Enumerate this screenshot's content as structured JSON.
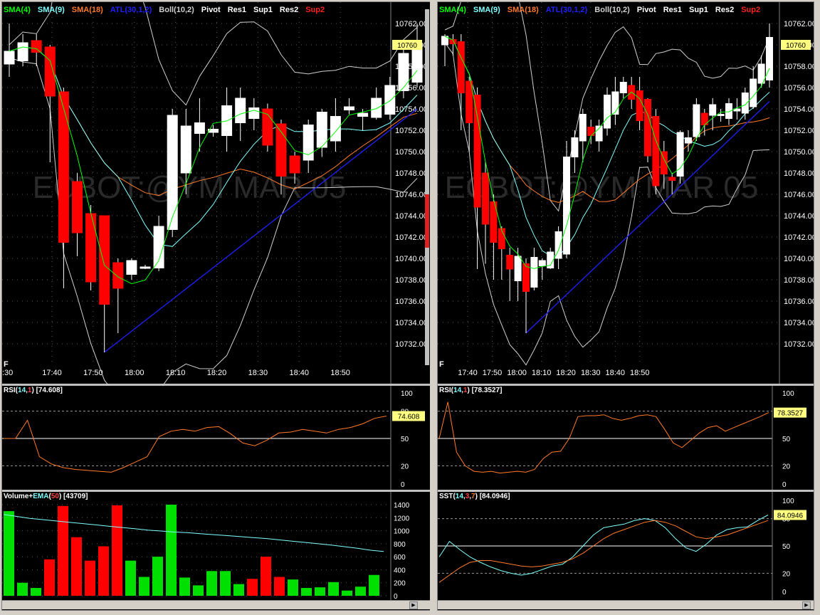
{
  "colors": {
    "up": "#ffffff",
    "down": "#ff0000",
    "sma4": "#00ff00",
    "sma9": "#7fffff",
    "sma18": "#ff7a2a",
    "atl": "#2020ff",
    "boll": "#cfcfcf",
    "pivot": "#ffffff",
    "res1": "#ffffff",
    "sup1": "#ffffff",
    "res2": "#ffffff",
    "sup2": "#ff2020",
    "label_bg": "#ffff80",
    "rsi_line": "#ff7a2a",
    "vol_up": "#00e000",
    "vol_down": "#ff0000",
    "ema": "#7fffff",
    "sst_k": "#7fffff",
    "sst_d": "#ff7a2a"
  },
  "left": {
    "legend": {
      "sma4": "SMA(4)",
      "sma9": "SMA(9)",
      "sma18": "SMA(18)",
      "atl": "ATL(30,1,2)",
      "boll": "Boll(10,2)",
      "pivot": "Pivot",
      "res1": "Res1",
      "sup1": "Sup1",
      "res2": "Res2",
      "sup2": "Sup2"
    },
    "watermark": "ECBOT:@YM  MAR 05",
    "corner_letter": "F",
    "last_price_label": "10760",
    "price_ticks": [
      "10762.00",
      "10760.00",
      "10758.00",
      "10756.00",
      "10754.00",
      "10752.00",
      "10750.00",
      "10748.00",
      "10746.00",
      "10744.00",
      "10742.00",
      "10740.00",
      "10738.00",
      "10736.00",
      "10734.00",
      "10732.00"
    ],
    "time_ticks": [
      "17:40",
      "17:50",
      "18:00",
      "18:10",
      "18:20",
      "18:30",
      "18:40",
      "18:50"
    ],
    "first_time_fragment": ":30",
    "candles": [
      [
        10758.2,
        10759.4,
        10762,
        10757
      ],
      [
        10758.5,
        10760.2,
        10761,
        10758
      ],
      [
        10760.4,
        10759.3,
        10761,
        10758
      ],
      [
        10759.8,
        10755.2,
        10760,
        10749
      ],
      [
        10755.6,
        10741.5,
        10756,
        10737.2
      ],
      [
        10747.2,
        10742.4,
        10748,
        10740.2
      ],
      [
        10744.2,
        10737.8,
        10745,
        10737
      ],
      [
        10744.0,
        10735.7,
        10744,
        10731.2
      ],
      [
        10739.6,
        10737.2,
        10740,
        10733
      ],
      [
        10738.5,
        10739.8,
        10740,
        10738
      ],
      [
        10739.1,
        10739.2,
        10739.4,
        10739
      ],
      [
        10739.1,
        10743.0,
        10744,
        10738.8
      ],
      [
        10742.7,
        10753.4,
        10754,
        10742
      ],
      [
        10748.0,
        10752.4,
        10754,
        10746
      ],
      [
        10751.7,
        10752.7,
        10755,
        10750
      ],
      [
        10751.8,
        10752.1,
        10752.5,
        10751.4
      ],
      [
        10751.5,
        10754.3,
        10756,
        10750
      ],
      [
        10752.7,
        10755.0,
        10756,
        10751
      ],
      [
        10753.1,
        10754.1,
        10755,
        10752
      ],
      [
        10754.0,
        10750.6,
        10754.5,
        10750
      ],
      [
        10752.6,
        10747.7,
        10753,
        10746
      ],
      [
        10749.6,
        10748.0,
        10750,
        10747
      ],
      [
        10749.2,
        10752.5,
        10753,
        10748
      ],
      [
        10750.4,
        10753.7,
        10754,
        10749.5
      ],
      [
        10751.0,
        10753.3,
        10755,
        10750
      ],
      [
        10753.9,
        10754.2,
        10755,
        10753.5
      ],
      [
        10753.3,
        10753.6,
        10754,
        10752
      ],
      [
        10753.2,
        10755.0,
        10756,
        10753
      ],
      [
        10753.5,
        10756.2,
        10757,
        10753
      ],
      [
        10755.7,
        10759.2,
        10760,
        10755
      ],
      [
        10756.5,
        10760.0,
        10762,
        10756
      ]
    ],
    "rsi_header": {
      "name": "RSI",
      "p1": "14",
      "p2": "1",
      "value": "[74.608]"
    },
    "rsi_ticks": [
      "100",
      "80",
      "50",
      "20",
      "0"
    ],
    "rsi_label": "74.608",
    "rsi": [
      50,
      50,
      70,
      30,
      22,
      18,
      16,
      15,
      14,
      13,
      18,
      24,
      30,
      52,
      58,
      60,
      58,
      62,
      63,
      55,
      45,
      42,
      48,
      56,
      57,
      60,
      58,
      56,
      60,
      62,
      66,
      72,
      74.6
    ],
    "volume_header": {
      "name": "Volume",
      "plus": "+",
      "ema": "EMA",
      "p": "50",
      "value": "[43709]"
    },
    "volume_ticks": [
      "1400",
      "1200",
      "1000",
      "800",
      "600",
      "400",
      "200",
      "0"
    ],
    "volume": [
      [
        1300,
        "u"
      ],
      [
        200,
        "u"
      ],
      [
        120,
        "u"
      ],
      [
        560,
        "d"
      ],
      [
        1380,
        "d"
      ],
      [
        900,
        "d"
      ],
      [
        540,
        "d"
      ],
      [
        760,
        "d"
      ],
      [
        1390,
        "d"
      ],
      [
        540,
        "u"
      ],
      [
        290,
        "u"
      ],
      [
        600,
        "u"
      ],
      [
        1400,
        "u"
      ],
      [
        280,
        "u"
      ],
      [
        160,
        "u"
      ],
      [
        380,
        "u"
      ],
      [
        380,
        "u"
      ],
      [
        180,
        "u"
      ],
      [
        260,
        "d"
      ],
      [
        600,
        "d"
      ],
      [
        290,
        "d"
      ],
      [
        250,
        "u"
      ],
      [
        120,
        "u"
      ],
      [
        130,
        "u"
      ],
      [
        210,
        "u"
      ],
      [
        80,
        "u"
      ],
      [
        140,
        "u"
      ],
      [
        320,
        "u"
      ]
    ],
    "ema": [
      1250,
      1220,
      1190,
      1170,
      1150,
      1130,
      1110,
      1090,
      1070,
      1050,
      1030,
      1010,
      995,
      980,
      970,
      955,
      940,
      925,
      910,
      895,
      880,
      860,
      840,
      820,
      800,
      780,
      755,
      730,
      700,
      680
    ]
  },
  "right": {
    "legend": {
      "sma4": "SMA(4)",
      "sma9": "SMA(9)",
      "sma18": "SMA(18)",
      "atl": "ATL(30,1,2)",
      "boll": "Boll(10,2)",
      "pivot": "Pivot",
      "res1": "Res1",
      "sup1": "Sup1",
      "res2": "Res2",
      "sup2": "Sup2"
    },
    "watermark": "ECBOT:@YM  MAR 05",
    "corner_letter": "F",
    "last_price_label": "10760",
    "price_ticks": [
      "10762.00",
      "10760.00",
      "10758.00",
      "10756.00",
      "10754.00",
      "10752.00",
      "10750.00",
      "10748.00",
      "10746.00",
      "10744.00",
      "10742.00",
      "10740.00",
      "10738.00",
      "10736.00",
      "10734.00",
      "10732.00"
    ],
    "time_ticks": [
      "17:40",
      "17:50",
      "18:00",
      "18:10",
      "18:20",
      "18:30",
      "18:40",
      "18:50"
    ],
    "candles": [
      [
        10760.0,
        10760.8,
        10761,
        10758
      ],
      [
        10760.5,
        10760.1,
        10761,
        10759
      ],
      [
        10760.3,
        10755.5,
        10761,
        10752
      ],
      [
        10756.6,
        10752.7,
        10757,
        10750
      ],
      [
        10755.3,
        10744.8,
        10756,
        10739
      ],
      [
        10748.0,
        10743.2,
        10749,
        10739.5
      ],
      [
        10745.3,
        10741.5,
        10746,
        10738
      ],
      [
        10742.8,
        10740.9,
        10743,
        10738
      ],
      [
        10740.3,
        10739.0,
        10741,
        10736
      ],
      [
        10737.9,
        10740.2,
        10741,
        10736
      ],
      [
        10739.5,
        10736.9,
        10740,
        10733
      ],
      [
        10737.3,
        10740.1,
        10741,
        10737
      ],
      [
        10739.3,
        10739.8,
        10740,
        10738
      ],
      [
        10739.1,
        10740.6,
        10741,
        10739
      ],
      [
        10740.0,
        10742.5,
        10743,
        10739
      ],
      [
        10740.4,
        10749.5,
        10751,
        10740
      ],
      [
        10749.5,
        10751.3,
        10752,
        10748
      ],
      [
        10751.0,
        10753.5,
        10754,
        10749
      ],
      [
        10752.3,
        10751.5,
        10753,
        10750.7
      ],
      [
        10751.0,
        10752.4,
        10753,
        10750
      ],
      [
        10752.2,
        10755.3,
        10756,
        10751.5
      ],
      [
        10753.5,
        10755.6,
        10757,
        10752.5
      ],
      [
        10755.5,
        10756.5,
        10757,
        10755
      ],
      [
        10756.2,
        10754.9,
        10757,
        10754
      ],
      [
        10755.7,
        10752.9,
        10757,
        10752
      ],
      [
        10754.9,
        10749.6,
        10755,
        10749
      ],
      [
        10753.3,
        10746.8,
        10754,
        10746
      ],
      [
        10750.0,
        10747.9,
        10751,
        10746.5
      ],
      [
        10747.6,
        10747.3,
        10748,
        10746
      ],
      [
        10747.7,
        10751.8,
        10752,
        10747
      ],
      [
        10750.8,
        10751.3,
        10752,
        10750
      ],
      [
        10751.4,
        10754.4,
        10755,
        10751
      ],
      [
        10753.6,
        10752.5,
        10754,
        10751.5
      ],
      [
        10753.4,
        10754.4,
        10755,
        10752
      ],
      [
        10753.5,
        10753.5,
        10754,
        10752.8
      ],
      [
        10753.1,
        10754.5,
        10755,
        10752.5
      ],
      [
        10753.8,
        10754.0,
        10755,
        10753
      ],
      [
        10753.6,
        10755.5,
        10756,
        10753
      ],
      [
        10754.2,
        10756.8,
        10758,
        10754
      ],
      [
        10756.4,
        10758.2,
        10759,
        10756
      ],
      [
        10756.7,
        10760.7,
        10762,
        10756
      ]
    ],
    "rsi_header": {
      "name": "RSI",
      "p1": "14",
      "p2": "1",
      "value": "[78.3527]"
    },
    "rsi_ticks": [
      "100",
      "80",
      "50",
      "20",
      "0"
    ],
    "rsi_label": "78.3527",
    "rsi": [
      50,
      90,
      35,
      20,
      14,
      13,
      14,
      12,
      13,
      14,
      13,
      16,
      28,
      35,
      36,
      50,
      74,
      75,
      75,
      76,
      72,
      70,
      72,
      75,
      76,
      74,
      60,
      45,
      40,
      48,
      56,
      62,
      64,
      58,
      62,
      66,
      70,
      74,
      78.4
    ],
    "sst_header": {
      "name": "SST",
      "p1": "14",
      "p2": "3",
      "p3": "7",
      "value": "[84.0946]"
    },
    "sst_ticks": [
      "100",
      "80",
      "50",
      "20",
      "0"
    ],
    "sst_label": "84.0946",
    "sst_k": [
      38,
      55,
      46,
      38,
      32,
      27,
      23,
      20,
      18,
      20,
      24,
      28,
      30,
      38,
      50,
      62,
      70,
      72,
      74,
      78,
      80,
      78,
      70,
      58,
      48,
      44,
      52,
      62,
      68,
      70,
      71,
      78,
      84
    ],
    "sst_d": [
      10,
      18,
      26,
      32,
      34,
      34,
      32,
      30,
      28,
      27,
      28,
      30,
      32,
      36,
      42,
      50,
      58,
      64,
      68,
      72,
      76,
      78,
      76,
      72,
      66,
      60,
      58,
      60,
      62,
      66,
      70,
      74,
      78
    ]
  }
}
